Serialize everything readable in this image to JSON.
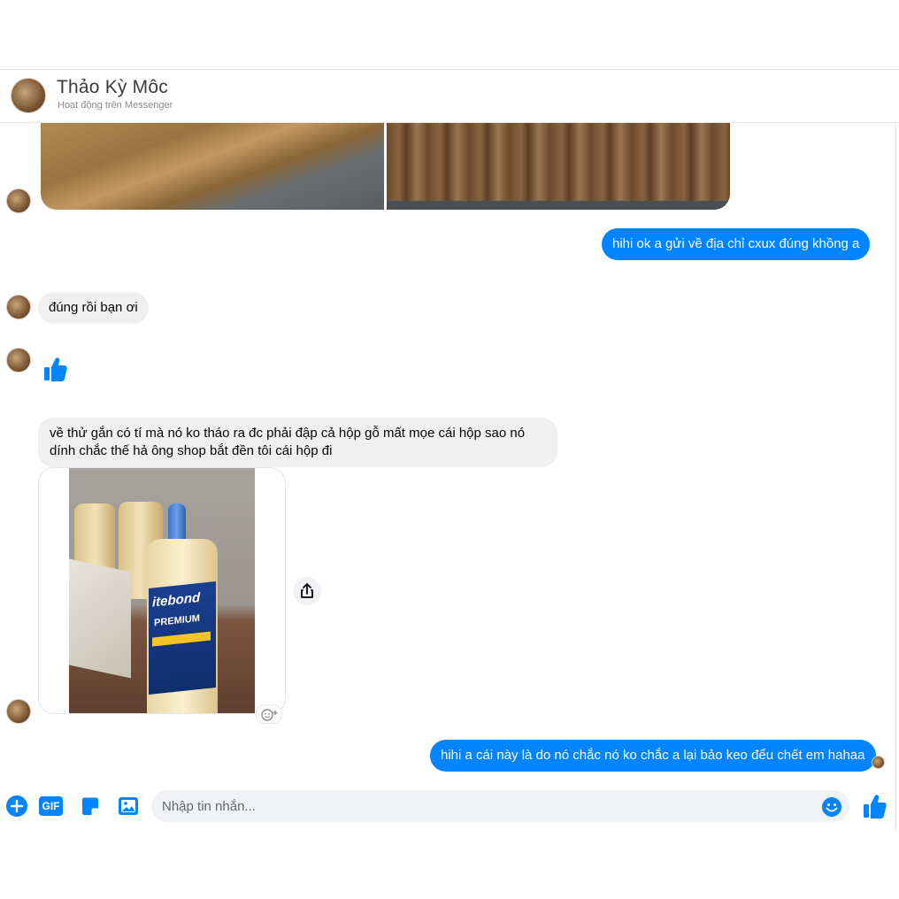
{
  "header": {
    "name": "Thảo Kỳ Môc",
    "status": "Hoạt động trên Messenger"
  },
  "messages": {
    "out1": "hihi ok a gửi về địa chỉ cxux đúng khồng a",
    "in1": "đúng rồi bạn ơi",
    "in2": "về thử gắn có tí mà nó ko tháo ra đc phải đập cả hộp gỗ mất mọe cái hộp sao nó dính chắc thế hả ông shop bắt đền tôi cái hộp đi",
    "out2": "hihi a cái này là do nó chắc nó ko chắc a lại bảo keo đểu chết em hahaa"
  },
  "product_label": {
    "brand": "itebond",
    "line": "PREMIUM"
  },
  "composer": {
    "placeholder": "Nhập tin nhắn...",
    "gif_label": "GIF"
  },
  "colors": {
    "accent": "#0084ff",
    "incoming_bubble": "#f0f0f0"
  }
}
